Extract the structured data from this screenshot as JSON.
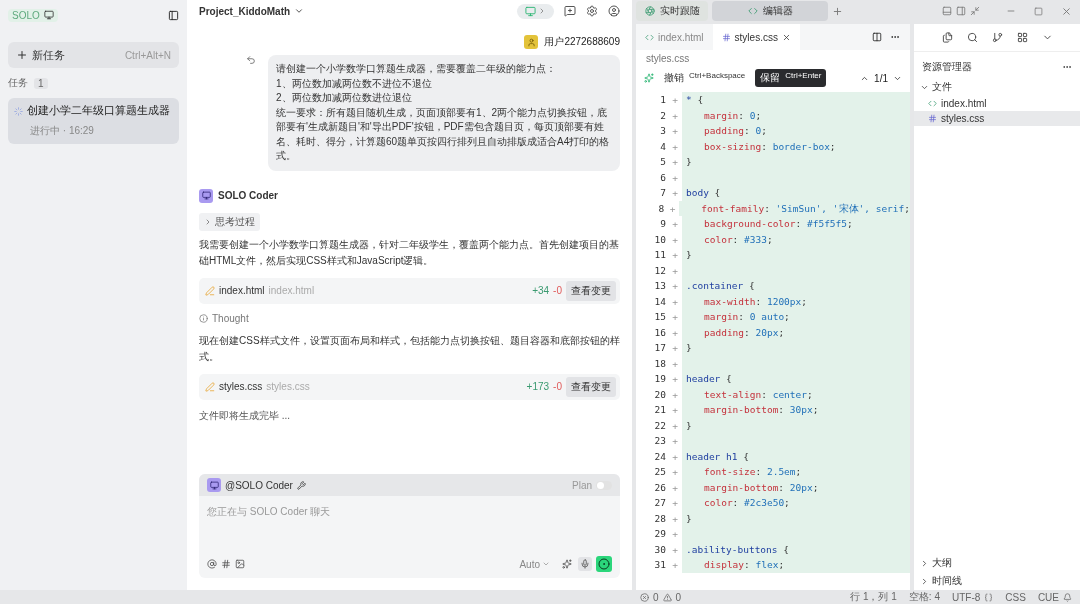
{
  "sidebar": {
    "logo": "SOLO",
    "new_task": {
      "label": "新任务",
      "shortcut": "Ctrl+Alt+N"
    },
    "tasks_label": "任务",
    "tasks_count": "1",
    "tasks": [
      {
        "title": "创建小学二年级口算题生成器",
        "status": "进行中 · 16:29",
        "selected": true
      }
    ]
  },
  "chat": {
    "project": "Project_KiddoMath",
    "user": "用户2272688609",
    "request": [
      "请创建一个小学数学口算题生成器，需要覆盖二年级的能力点：",
      "1、两位数加减两位数不进位不退位",
      "2、两位数加减两位数进位退位",
      "统一要求：所有题目随机生成，页面顶部要有1、2两个能力点切换按钮，底部要有'生成新题目'和'导出PDF'按钮，PDF需包含题目页，每页顶部要有姓名、耗时、得分，计算题60题单页按四行排列且自动排版成适合A4打印的格式。"
    ],
    "agent": "SOLO Coder",
    "thinking": {
      "label": "思考过程",
      "expanded": false
    },
    "messages": [
      {
        "kind": "text",
        "text": "我需要创建一个小学数学口算题生成器，针对二年级学生，覆盖两个能力点。首先创建项目的基础HTML文件，然后实现CSS样式和JavaScript逻辑。"
      },
      {
        "kind": "file",
        "name": "index.html",
        "path": "index.html",
        "added": "+34",
        "removed": "-0",
        "action": "查看变更"
      },
      {
        "kind": "thought",
        "text": "Thought"
      },
      {
        "kind": "text",
        "text": "现在创建CSS样式文件，设置页面布局和样式，包括能力点切换按钮、题目容器和底部按钮的样式。"
      },
      {
        "kind": "file",
        "name": "styles.css",
        "path": "styles.css",
        "added": "+173",
        "removed": "-0",
        "action": "查看变更"
      },
      {
        "kind": "status",
        "text": "文件即将生成完毕 ..."
      }
    ],
    "composer": {
      "mention": "@SOLO Coder",
      "plan_label": "Plan",
      "plan_on": false,
      "placeholder": "您正在与 SOLO Coder 聊天",
      "mode": "Auto"
    }
  },
  "workspace": {
    "tabs": [
      {
        "label": "实时跟随",
        "selected": false
      },
      {
        "label": "编辑器",
        "selected": true
      }
    ],
    "editor": {
      "tabs": [
        {
          "label": "index.html",
          "kind": "html",
          "selected": false
        },
        {
          "label": "styles.css",
          "kind": "css",
          "selected": true
        }
      ],
      "breadcrumb": "styles.css",
      "undo": "撤销",
      "undo_key": "Ctrl+Backspace",
      "keep": "保留",
      "keep_key": "Ctrl+Enter",
      "counter": "1/1",
      "lines": [
        {
          "n": "1",
          "mark": "+",
          "kind": "rule",
          "text": "* {"
        },
        {
          "n": "2",
          "mark": "+",
          "kind": "decl",
          "text": "margin: 0;"
        },
        {
          "n": "3",
          "mark": "+",
          "kind": "decl",
          "text": "padding: 0;"
        },
        {
          "n": "4",
          "mark": "+",
          "kind": "decl",
          "text": "box-sizing: border-box;"
        },
        {
          "n": "5",
          "mark": "+",
          "kind": "rule",
          "text": "}"
        },
        {
          "n": "6",
          "mark": "+",
          "kind": "blank"
        },
        {
          "n": "7",
          "mark": "+",
          "kind": "rule",
          "text": "body {"
        },
        {
          "n": "8",
          "mark": "+",
          "kind": "decl",
          "text": "font-family: 'SimSun', '宋体', serif;"
        },
        {
          "n": "9",
          "mark": "+",
          "kind": "decl",
          "text": "background-color: #f5f5f5;"
        },
        {
          "n": "10",
          "mark": "+",
          "kind": "decl",
          "text": "color: #333;"
        },
        {
          "n": "11",
          "mark": "+",
          "kind": "rule",
          "text": "}"
        },
        {
          "n": "12",
          "mark": "+",
          "kind": "blank"
        },
        {
          "n": "13",
          "mark": "+",
          "kind": "rule",
          "text": ".container {"
        },
        {
          "n": "14",
          "mark": "+",
          "kind": "decl",
          "text": "max-width: 1200px;"
        },
        {
          "n": "15",
          "mark": "+",
          "kind": "decl",
          "text": "margin: 0 auto;"
        },
        {
          "n": "16",
          "mark": "+",
          "kind": "decl",
          "text": "padding: 20px;"
        },
        {
          "n": "17",
          "mark": "+",
          "kind": "rule",
          "text": "}"
        },
        {
          "n": "18",
          "mark": "+",
          "kind": "blank"
        },
        {
          "n": "19",
          "mark": "+",
          "kind": "rule",
          "text": "header {"
        },
        {
          "n": "20",
          "mark": "+",
          "kind": "decl",
          "text": "text-align: center;"
        },
        {
          "n": "21",
          "mark": "+",
          "kind": "decl",
          "text": "margin-bottom: 30px;"
        },
        {
          "n": "22",
          "mark": "+",
          "kind": "rule",
          "text": "}"
        },
        {
          "n": "23",
          "mark": "+",
          "kind": "blank"
        },
        {
          "n": "24",
          "mark": "+",
          "kind": "rule",
          "text": "header h1 {"
        },
        {
          "n": "25",
          "mark": "+",
          "kind": "decl",
          "text": "font-size: 2.5em;"
        },
        {
          "n": "26",
          "mark": "+",
          "kind": "decl",
          "text": "margin-bottom: 20px;"
        },
        {
          "n": "27",
          "mark": "+",
          "kind": "decl",
          "text": "color: #2c3e50;"
        },
        {
          "n": "28",
          "mark": "+",
          "kind": "rule",
          "text": "}"
        },
        {
          "n": "29",
          "mark": "+",
          "kind": "blank"
        },
        {
          "n": "30",
          "mark": "+",
          "kind": "rule",
          "text": ".ability-buttons {"
        },
        {
          "n": "31",
          "mark": "+",
          "kind": "decl",
          "text": "display: flex;"
        }
      ]
    },
    "explorer": {
      "title": "资源管理器",
      "sections": [
        {
          "label": "文件",
          "expanded": true,
          "files": [
            {
              "label": "index.html",
              "kind": "html",
              "selected": false
            },
            {
              "label": "styles.css",
              "kind": "css",
              "selected": true
            }
          ]
        }
      ],
      "collapsed": [
        {
          "label": "大纲",
          "expanded": false
        },
        {
          "label": "时间线",
          "expanded": false
        }
      ]
    }
  },
  "status_bar": {
    "errors": "0",
    "warnings": "0",
    "items": [
      "行 1，列 1",
      "空格: 4",
      "UTF-8"
    ],
    "language": "CSS",
    "cue": "CUE"
  }
}
